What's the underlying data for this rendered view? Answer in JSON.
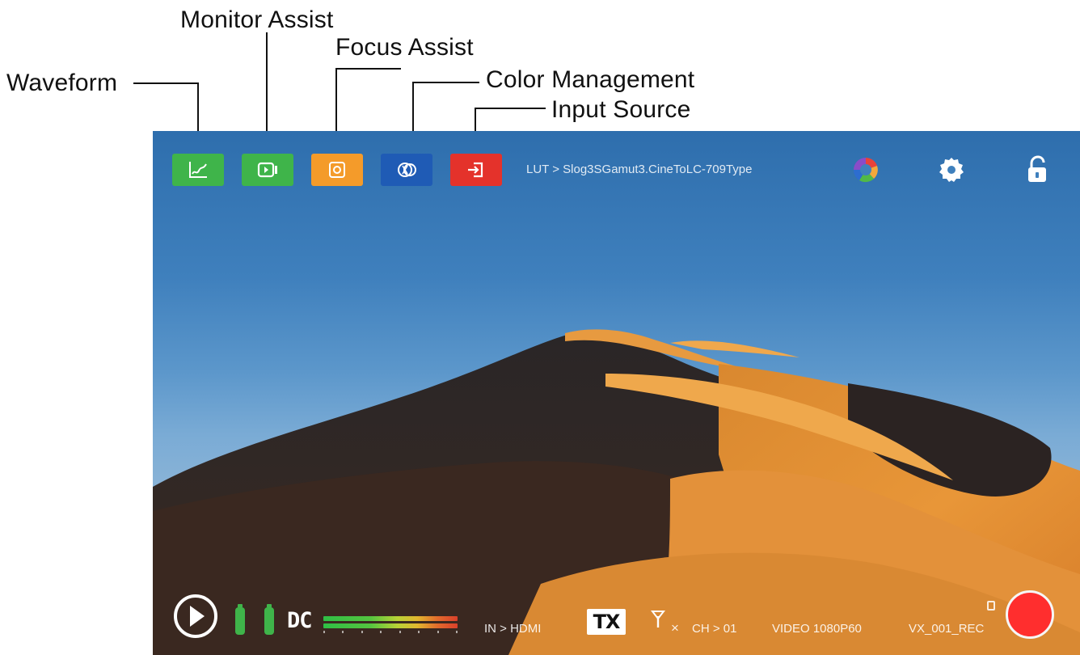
{
  "callouts": {
    "monitor_assist": "Monitor Assist",
    "focus_assist": "Focus Assist",
    "waveform": "Waveform",
    "color_management": "Color Management",
    "input_source": "Input Source"
  },
  "toolbar": {
    "buttons": [
      {
        "name": "waveform",
        "icon": "waveform-graph-icon",
        "color": "#3fb44a"
      },
      {
        "name": "monitor-assist",
        "icon": "monitor-assist-icon",
        "color": "#3fb44a"
      },
      {
        "name": "focus-assist",
        "icon": "focus-assist-icon",
        "color": "#f49b2a"
      },
      {
        "name": "color-management",
        "icon": "color-management-icon",
        "color": "#1f5bb5"
      },
      {
        "name": "input-source",
        "icon": "input-source-icon",
        "color": "#e4322b"
      }
    ],
    "lut_label": "LUT > Slog3SGamut3.CineToLC-709Type",
    "right_icons": [
      "color-wheel-icon",
      "gear-icon",
      "unlock-icon"
    ]
  },
  "status_bar": {
    "play_icon": "play-icon",
    "battery_icon": "battery-icon",
    "power_label": "DC",
    "audio_meter_icon": "audio-level-meter",
    "input_label": "IN > HDMI",
    "tx_label": "TX",
    "antenna_icon": "antenna-icon",
    "no_signal_glyph": "×",
    "channel_label": "CH > 01",
    "video_label": "VIDEO 1080P60",
    "filename_label": "VX_001_REC",
    "storage_icon": "sd-card-icon",
    "record_icon": "record-button"
  },
  "colors": {
    "green": "#3fb44a",
    "orange": "#f49b2a",
    "blue": "#1f5bb5",
    "red": "#e4322b",
    "record": "#ff2e2e"
  }
}
